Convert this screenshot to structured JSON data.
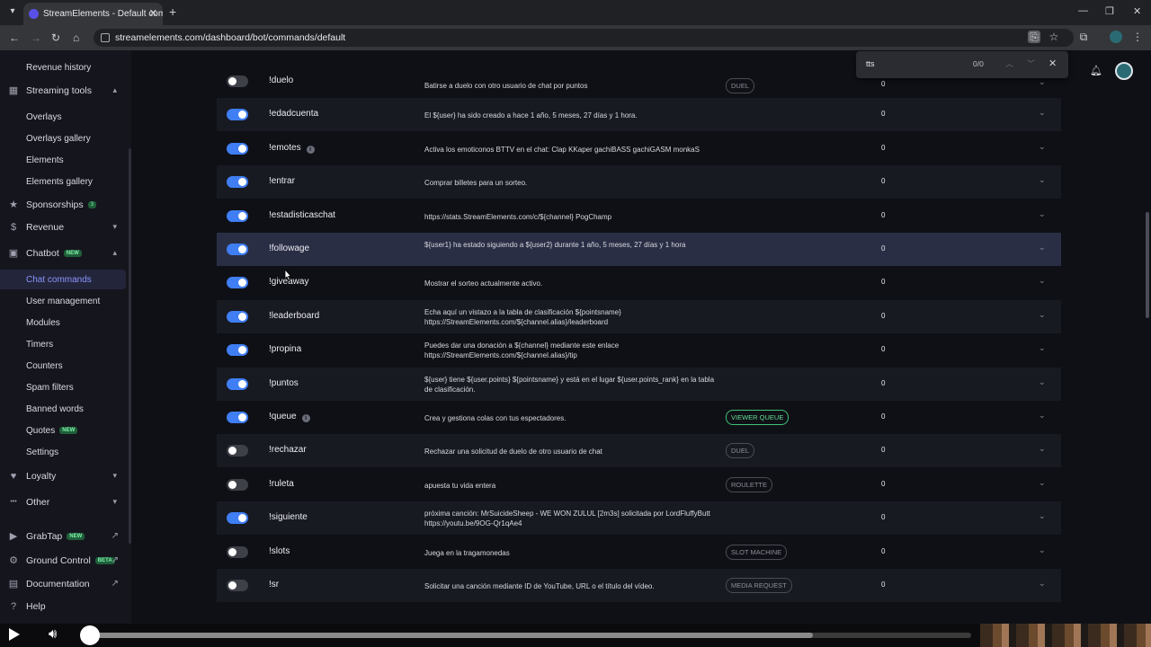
{
  "browser": {
    "tab_title": "StreamElements - Default comm",
    "url": "streamelements.com/dashboard/bot/commands/default"
  },
  "find": {
    "query": "tts",
    "count": "0/0"
  },
  "sidebar": {
    "items": [
      {
        "label": "Revenue history",
        "kind": "sub"
      },
      {
        "label": "Streaming tools",
        "kind": "top",
        "icon": "grid-icon"
      },
      {
        "label": "Overlays",
        "kind": "sub"
      },
      {
        "label": "Overlays gallery",
        "kind": "sub"
      },
      {
        "label": "Elements",
        "kind": "sub"
      },
      {
        "label": "Elements gallery",
        "kind": "sub"
      },
      {
        "label": "Sponsorships",
        "kind": "top",
        "icon": "star-icon",
        "badge": "3"
      },
      {
        "label": "Revenue",
        "kind": "top",
        "icon": "dollar-icon"
      },
      {
        "label": "Chatbot",
        "kind": "top",
        "icon": "chat-icon",
        "badge": "NEW"
      },
      {
        "label": "Chat commands",
        "kind": "sub",
        "active": true
      },
      {
        "label": "User management",
        "kind": "sub"
      },
      {
        "label": "Modules",
        "kind": "sub"
      },
      {
        "label": "Timers",
        "kind": "sub"
      },
      {
        "label": "Counters",
        "kind": "sub"
      },
      {
        "label": "Spam filters",
        "kind": "sub"
      },
      {
        "label": "Banned words",
        "kind": "sub"
      },
      {
        "label": "Quotes",
        "kind": "sub",
        "badge": "NEW"
      },
      {
        "label": "Settings",
        "kind": "sub"
      },
      {
        "label": "Loyalty",
        "kind": "top",
        "icon": "heart-icon"
      },
      {
        "label": "Other",
        "kind": "top",
        "icon": "dots-icon"
      },
      {
        "label": "GrabTap",
        "kind": "top",
        "icon": "grabtap-icon",
        "badge": "NEW"
      },
      {
        "label": "Ground Control",
        "kind": "top",
        "icon": "ground-icon",
        "badge": "BETA"
      },
      {
        "label": "Documentation",
        "kind": "top",
        "icon": "doc-icon"
      },
      {
        "label": "Help",
        "kind": "top",
        "icon": "help-icon"
      }
    ]
  },
  "commands": [
    {
      "name": "!duelo",
      "on": false,
      "response": "Batirse a duelo con otro usuario de chat por puntos",
      "tag": "DUEL",
      "count": "0"
    },
    {
      "name": "!edadcuenta",
      "on": true,
      "response": "El ${user} ha sido creado a hace 1 año, 5 meses, 27 días y 1 hora.",
      "tag": "",
      "count": "0"
    },
    {
      "name": "!emotes",
      "on": true,
      "info": true,
      "response": "Activa los emoticonos BTTV en el chat: Clap KKaper gachiBASS gachiGASM monkaS",
      "tag": "",
      "count": "0"
    },
    {
      "name": "!entrar",
      "on": true,
      "response": "Comprar billetes para un sorteo.",
      "tag": "",
      "count": "0"
    },
    {
      "name": "!estadisticaschat",
      "on": true,
      "response": "https://stats.StreamElements.com/c/${channel} PogChamp",
      "tag": "",
      "count": "0"
    },
    {
      "name": "!followage",
      "on": true,
      "response": "${user1} ha estado siguiendo a ${user2} durante 1 año, 5 meses, 27 días y 1 hora",
      "tag": "",
      "count": "0",
      "highlight": true
    },
    {
      "name": "!giveaway",
      "on": true,
      "response": "Mostrar el sorteo actualmente activo.",
      "tag": "",
      "count": "0"
    },
    {
      "name": "!leaderboard",
      "on": true,
      "response": "Echa aquí un vistazo a la tabla de clasificación ${pointsname} https://StreamElements.com/${channel.alias}/leaderboard",
      "tag": "",
      "count": "0"
    },
    {
      "name": "!propina",
      "on": true,
      "response": "Puedes dar una donación a ${channel} mediante este enlace https://StreamElements.com/${channel.alias}/tip",
      "tag": "",
      "count": "0"
    },
    {
      "name": "!puntos",
      "on": true,
      "response": "${user} tiene ${user.points} ${pointsname} y está en el lugar ${user.points_rank} en la tabla de clasificación.",
      "tag": "",
      "count": "0"
    },
    {
      "name": "!queue",
      "on": true,
      "info": true,
      "response": "Crea y gestiona colas con tus espectadores.",
      "tag": "VIEWER QUEUE",
      "tag_green": true,
      "count": "0"
    },
    {
      "name": "!rechazar",
      "on": false,
      "response": "Rechazar una solicitud de duelo de otro usuario de chat",
      "tag": "DUEL",
      "count": "0"
    },
    {
      "name": "!ruleta",
      "on": false,
      "response": "apuesta tu vida entera",
      "tag": "ROULETTE",
      "count": "0"
    },
    {
      "name": "!siguiente",
      "on": true,
      "response": "próxima canción: MrSuicideSheep - WE WON ZULUL [2m3s] solicitada por LordFluffyButt https://youtu.be/9OG-Qr1qAe4",
      "tag": "",
      "count": "0"
    },
    {
      "name": "!slots",
      "on": false,
      "response": "Juega en la tragamonedas",
      "tag": "SLOT MACHINE",
      "count": "0"
    },
    {
      "name": "!sr",
      "on": false,
      "response": "Solicitar una canción mediante ID de YouTube, URL o el título del vídeo.",
      "tag": "MEDIA REQUEST",
      "count": "0"
    }
  ],
  "video": {
    "progress": 0.82
  }
}
